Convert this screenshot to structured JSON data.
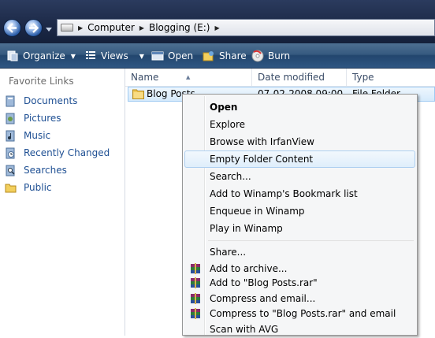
{
  "address": {
    "crumbs": [
      "Computer",
      "Blogging  (E:)"
    ]
  },
  "toolbar": {
    "organize": "Organize",
    "views": "Views",
    "open": "Open",
    "share": "Share",
    "burn": "Burn"
  },
  "favorites": {
    "title": "Favorite Links",
    "items": [
      {
        "label": "Documents",
        "icon": "documents-icon"
      },
      {
        "label": "Pictures",
        "icon": "pictures-icon"
      },
      {
        "label": "Music",
        "icon": "music-icon"
      },
      {
        "label": "Recently Changed",
        "icon": "recently-changed-icon"
      },
      {
        "label": "Searches",
        "icon": "searches-icon"
      },
      {
        "label": "Public",
        "icon": "public-folder-icon"
      }
    ]
  },
  "columns": {
    "name": "Name",
    "date": "Date modified",
    "type": "Type"
  },
  "file": {
    "name": "Blog Posts",
    "date": "07-02-2008 09:00",
    "type": "File Folder"
  },
  "context_menu": {
    "items": [
      {
        "label": "Open",
        "bold": true
      },
      {
        "label": "Explore"
      },
      {
        "label": "Browse with IrfanView"
      },
      {
        "label": "Empty Folder Content",
        "hover": true
      },
      {
        "label": "Search..."
      },
      {
        "label": "Add to Winamp's Bookmark list"
      },
      {
        "label": "Enqueue in Winamp"
      },
      {
        "label": "Play in Winamp"
      },
      {
        "label": "Share..."
      },
      {
        "label": "Add to archive...",
        "icon": "winrar-icon"
      },
      {
        "label": "Add to \"Blog Posts.rar\"",
        "icon": "winrar-icon"
      },
      {
        "label": "Compress and email...",
        "icon": "winrar-icon"
      },
      {
        "label": "Compress to \"Blog Posts.rar\" and email",
        "icon": "winrar-icon"
      },
      {
        "label": "Scan with AVG"
      }
    ]
  },
  "colors": {
    "link": "#1e4f93",
    "toolbar": "#2f5682",
    "selection": "#d5eafb"
  }
}
